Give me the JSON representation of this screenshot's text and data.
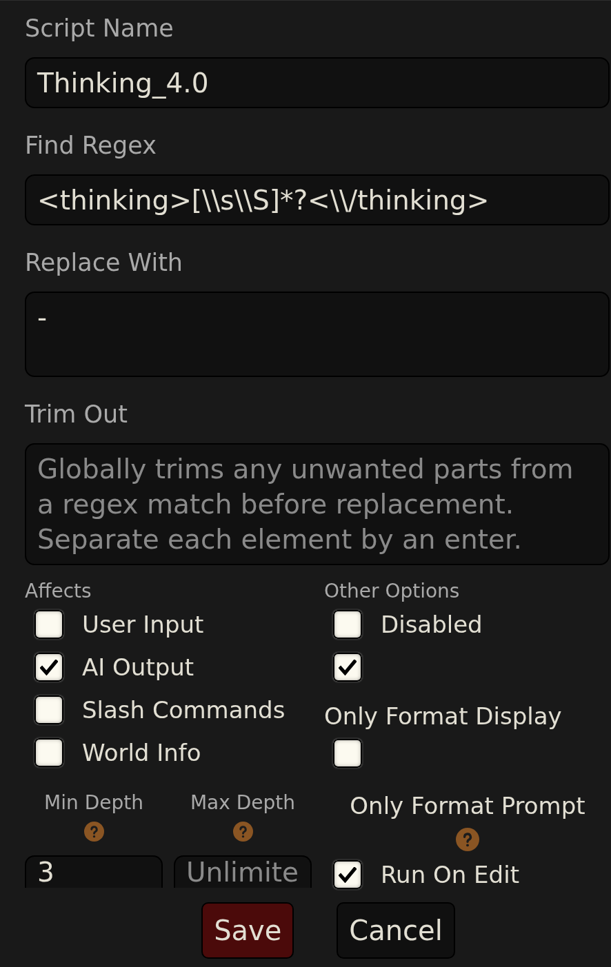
{
  "fields": [
    {
      "kind": "input",
      "label": "Script Name",
      "value": "Thinking_4.0"
    },
    {
      "kind": "input",
      "label": "Find Regex",
      "value": "<thinking>[\\\\s\\\\S]*?<\\\\/thinking>"
    },
    {
      "kind": "textarea",
      "label": "Replace With",
      "value": "-"
    },
    {
      "kind": "textarea",
      "label": "Trim Out",
      "placeholder": "Globally trims any unwanted parts from a regex match before replacement. Separate each element by an enter."
    }
  ],
  "affects": {
    "title": "Affects",
    "options": [
      {
        "label": "User Input",
        "checked": false
      },
      {
        "label": "AI Output",
        "checked": true
      },
      {
        "label": "Slash Commands",
        "checked": false
      },
      {
        "label": "World Info",
        "checked": false
      }
    ]
  },
  "depth": [
    {
      "label": "Min Depth",
      "help": true,
      "value": "3"
    },
    {
      "label": "Max Depth",
      "help": true,
      "placeholder": "Unlimite"
    }
  ],
  "other_options": {
    "title": "Other Options",
    "items": [
      {
        "kind": "checkbox",
        "label": "Disabled",
        "checked": false
      },
      {
        "kind": "checkbox",
        "checked": true
      },
      {
        "kind": "heading",
        "label": "Only Format Display",
        "help": false
      },
      {
        "kind": "checkbox",
        "checked": false
      },
      {
        "kind": "heading",
        "label": "Only Format Prompt",
        "help": true
      },
      {
        "kind": "checkbox",
        "label": "Run On Edit",
        "checked": true
      }
    ]
  },
  "buttons": [
    {
      "kind": "confirm",
      "label": "Save"
    },
    {
      "kind": "cancel",
      "label": "Cancel"
    }
  ]
}
